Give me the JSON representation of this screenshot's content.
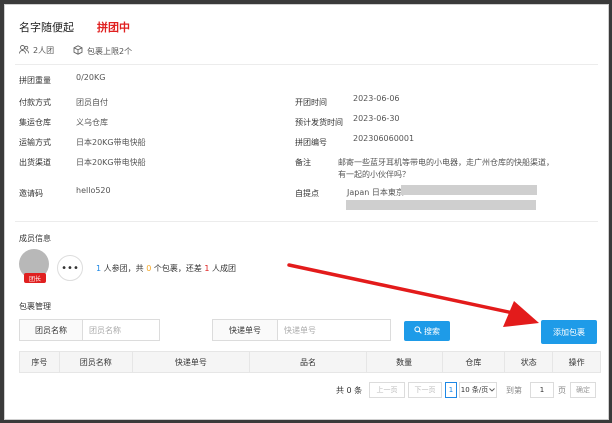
{
  "header": {
    "title": "名字随便起",
    "status": "拼团中",
    "members_meta": "2人团",
    "package_meta": "包裹上限2个"
  },
  "details": {
    "weight": {
      "label": "拼团重量",
      "value": "0/20KG"
    },
    "payment": {
      "label": "付款方式",
      "value": "团员自付"
    },
    "warehouse": {
      "label": "集运仓库",
      "value": "义乌仓库"
    },
    "transport": {
      "label": "运输方式",
      "value": "日本20KG带电快船"
    },
    "channel": {
      "label": "出货渠道",
      "value": "日本20KG带电快船"
    },
    "invite": {
      "label": "邀请码",
      "value": "hello520"
    },
    "open_time": {
      "label": "开团时间",
      "value": "2023-06-06"
    },
    "ship_time": {
      "label": "预计发货时间",
      "value": "2023-06-30"
    },
    "group_no": {
      "label": "拼团编号",
      "value": "202306060001"
    },
    "remark": {
      "label": "备注",
      "value": "邮寄一些蓝牙耳机等带电的小电器，走广州仓库的快船渠道，有一起的小伙伴吗？"
    },
    "pickup": {
      "label": "自提点",
      "value": "Japan 日本東京"
    }
  },
  "members": {
    "title": "成员信息",
    "captain_badge": "团长",
    "more": "•••",
    "summary": {
      "joined": "1",
      "t1": "人参团，共",
      "packages": "0",
      "t2": "个包裹，还差",
      "missing": "1",
      "t3": "人成团"
    }
  },
  "packages": {
    "title": "包裹管理",
    "member_name_label": "团员名称",
    "member_name_placeholder": "团员名称",
    "tracking_label": "快递单号",
    "tracking_placeholder": "快递单号",
    "search_label": "搜索",
    "add_label": "添加包裹",
    "columns": [
      "序号",
      "团员名称",
      "快递单号",
      "品名",
      "数量",
      "仓库",
      "状态",
      "操作"
    ]
  },
  "pagination": {
    "total": "共 0 条",
    "prev": "上一页",
    "next": "下一页",
    "page": "1",
    "page_size": "10 条/页",
    "goto": "到第",
    "goto_value": "1",
    "page_unit": "页",
    "confirm": "确定"
  },
  "colors": {
    "accent": "#1e9be8",
    "status": "#e02020",
    "annotation_arrow": "#e31b1b"
  }
}
